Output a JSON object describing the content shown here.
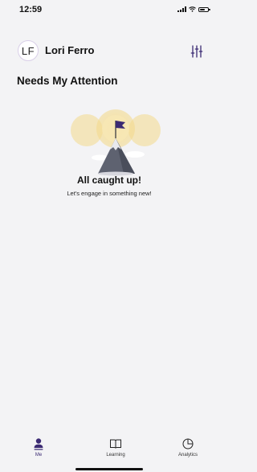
{
  "status_bar": {
    "time": "12:59"
  },
  "header": {
    "avatar_initials": "LF",
    "user_name": "Lori Ferro",
    "filter_icon": "sliders-icon"
  },
  "section": {
    "title": "Needs My Attention"
  },
  "empty_state": {
    "title": "All caught up!",
    "subtitle": "Let's engage in something new!",
    "illustration_icon": "mountain-flag-icon"
  },
  "tabs": [
    {
      "label": "Me",
      "icon": "person-icon",
      "active": true
    },
    {
      "label": "Learning",
      "icon": "book-icon",
      "active": false
    },
    {
      "label": "Analytics",
      "icon": "pie-chart-icon",
      "active": false
    }
  ],
  "colors": {
    "background": "#f3f3f5",
    "accent": "#3b2a73",
    "illustration_glow": "#f3d98a",
    "mountain": "#5e6270"
  }
}
